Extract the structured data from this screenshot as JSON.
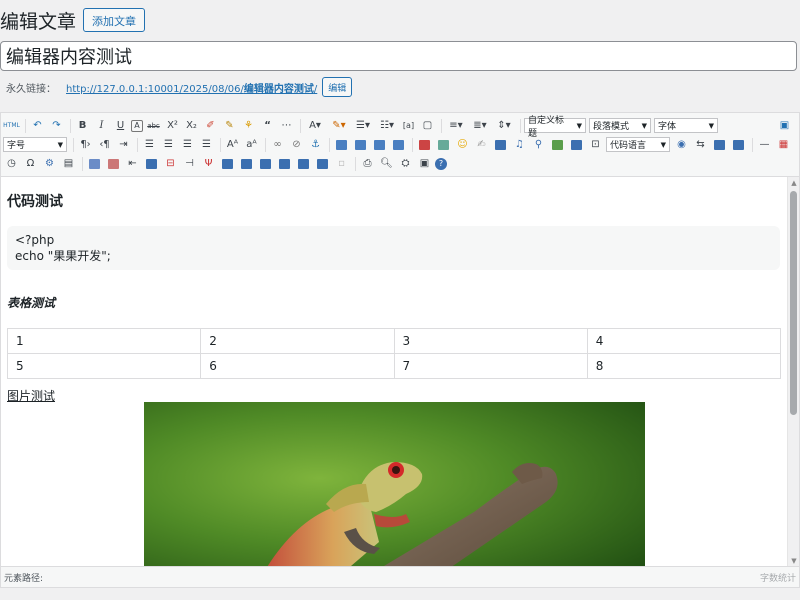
{
  "header": {
    "title": "编辑文章",
    "add_button": "添加文章"
  },
  "post": {
    "title": "编辑器内容测试"
  },
  "permalink": {
    "label": "永久链接：",
    "url_prefix": "http://127.0.0.1:10001/2025/08/06/",
    "url_slug": "编辑器内容测试",
    "url_suffix": "/",
    "edit_button": "编辑"
  },
  "toolbar": {
    "dropdowns": {
      "custom_heading": "自定义标题",
      "paragraph_style": "段落模式",
      "font_family": "字体",
      "font_size": "字号",
      "code_language": "代码语言"
    },
    "row1_icons": [
      "html-icon",
      "undo-icon",
      "redo-icon",
      "bold-icon",
      "italic-icon",
      "underline-icon",
      "text-box-icon",
      "strikethrough-icon",
      "superscript-icon",
      "subscript-icon",
      "eraser-icon",
      "paint-brush-icon",
      "paint-format-icon",
      "quote-icon",
      "code-icon",
      "font-color-icon",
      "highlight-icon",
      "ordered-list-icon",
      "unordered-list-icon",
      "select-all-icon",
      "paste-text-icon",
      "row-spacing-icon",
      "paragraph-spacing-icon",
      "line-height-icon"
    ],
    "row2_icons": [
      "ltr-icon",
      "rtl-icon",
      "indent-icon",
      "align-left-icon",
      "align-center-icon",
      "align-right-icon",
      "align-justify-icon",
      "uppercase-icon",
      "lowercase-icon",
      "link-icon",
      "unlink-icon",
      "anchor-icon",
      "image-left-icon",
      "image-none-icon",
      "image-right-icon",
      "image-center-icon",
      "single-image-icon",
      "multi-image-icon",
      "emoji-icon",
      "scrawl-icon",
      "video-icon",
      "music-icon",
      "attachment-icon",
      "map-icon",
      "insert-frame-icon",
      "page-break-icon",
      "background-icon",
      "template-icon",
      "horizontal-rule-icon",
      "date-icon"
    ],
    "row3_icons": [
      "time-icon",
      "special-char-icon",
      "wordimage-icon",
      "print-icon",
      "insert-table-icon",
      "delete-table-icon",
      "insert-row-icon",
      "insert-column-icon",
      "merge-cells-icon",
      "merge-right-icon",
      "merge-down-icon",
      "split-cells-icon",
      "split-rows-icon",
      "split-cols-icon",
      "delete-row-icon",
      "delete-col-icon",
      "table-properties-icon",
      "preview-icon",
      "search-replace-icon",
      "drafts-icon",
      "help-icon"
    ]
  },
  "content": {
    "heading_code": "代码测试",
    "code_lines": [
      "<?php",
      "echo \"果果开发\";"
    ],
    "heading_table": "表格测试",
    "table_rows": [
      [
        "1",
        "2",
        "3",
        "4"
      ],
      [
        "5",
        "6",
        "7",
        "8"
      ]
    ],
    "heading_image": "图片测试"
  },
  "status": {
    "path_label": "元素路径:",
    "word_count": "字数统计"
  }
}
